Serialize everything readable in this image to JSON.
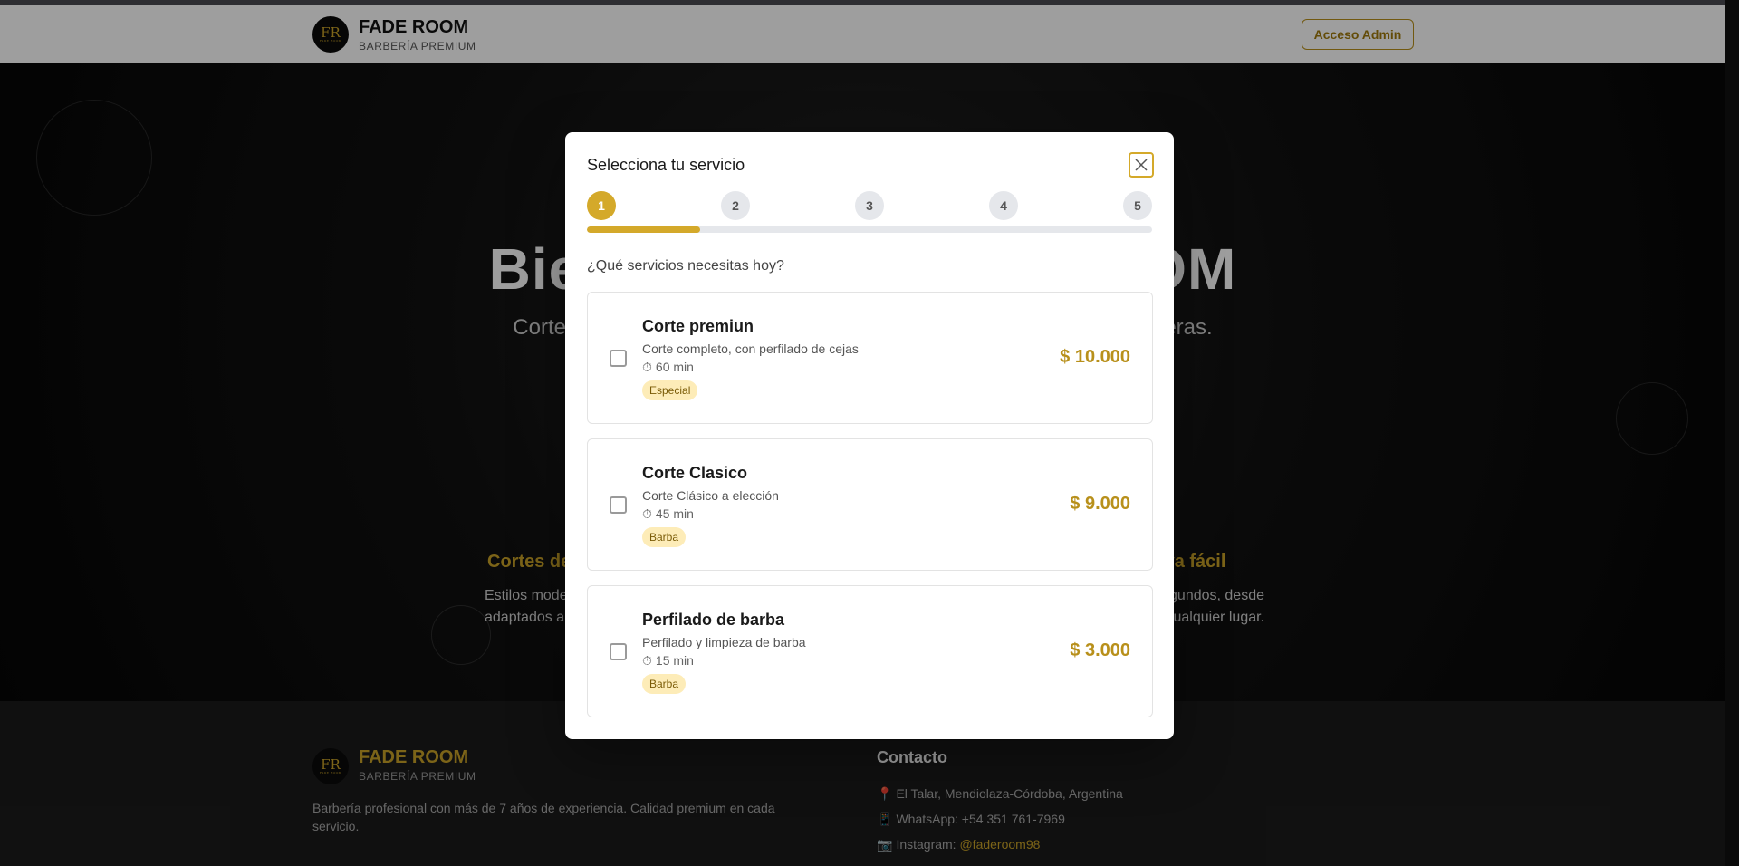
{
  "header": {
    "logo_text": "FR",
    "logo_subtext": "FADE ROOM",
    "brand_name": "FADE ROOM",
    "brand_sub": "BARBERÍA PREMIUM",
    "admin_button": "Acceso Admin"
  },
  "hero": {
    "title": "Bienvenido a FADE ROOM",
    "subtitle": "Cortes modernos y clásicos. Reservá tu turno en segundos, sin esperas.",
    "features": [
      {
        "title": "Cortes de calidad",
        "text_line1": "Estilos modernos y clásicos",
        "text_line2": "adaptados a vos"
      },
      {
        "title": "Reserva fácil",
        "text_line1": "Reservá tu turno en segundos, desde",
        "text_line2": "cualquier lugar."
      }
    ]
  },
  "footer": {
    "brand_name": "FADE ROOM",
    "brand_sub": "BARBERÍA PREMIUM",
    "description": "Barbería profesional con más de 7 años de experiencia. Calidad premium en cada servicio.",
    "contact_title": "Contacto",
    "address": "El Talar, Mendiolaza-Córdoba, Argentina",
    "whatsapp": "WhatsApp: +54 351 761-7969",
    "instagram_label": "Instagram: ",
    "instagram_handle": "@faderoom98"
  },
  "modal": {
    "title": "Selecciona tu servicio",
    "steps": [
      "1",
      "2",
      "3",
      "4",
      "5"
    ],
    "current_step": 1,
    "progress": 0.2,
    "question": "¿Qué servicios necesitas hoy?",
    "services": [
      {
        "name": "Corte premiun",
        "description": "Corte completo, con perfilado de cejas",
        "duration": "60 min",
        "badge": "Especial",
        "price": "$ 10.000",
        "checked": false
      },
      {
        "name": "Corte Clasico",
        "description": "Corte Clásico a elección",
        "duration": "45 min",
        "badge": "Barba",
        "price": "$ 9.000",
        "checked": false
      },
      {
        "name": "Perfilado de barba",
        "description": "Perfilado y limpieza de barba",
        "duration": "15 min",
        "badge": "Barba",
        "price": "$ 3.000",
        "checked": false
      }
    ]
  },
  "colors": {
    "accent": "#d4a92a",
    "price": "#b8901b",
    "badge_bg": "#fdecb8"
  },
  "icons": {
    "close": "close-icon",
    "timer": "timer-icon",
    "location": "pin-icon",
    "whatsapp": "phone-icon",
    "instagram": "camera-icon"
  }
}
